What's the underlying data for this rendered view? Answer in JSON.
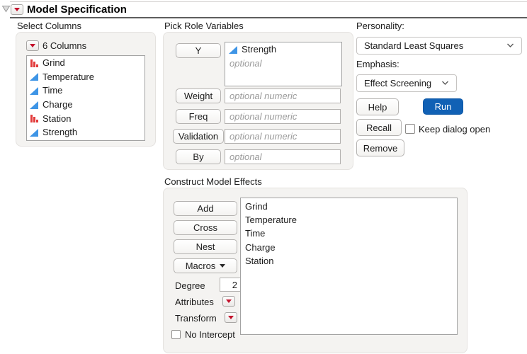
{
  "title": {
    "text": "Model Specification"
  },
  "select_columns": {
    "label": "Select Columns",
    "count_label": "6 Columns",
    "columns": [
      {
        "name": "Grind",
        "type": "nominal"
      },
      {
        "name": "Temperature",
        "type": "continuous"
      },
      {
        "name": "Time",
        "type": "continuous"
      },
      {
        "name": "Charge",
        "type": "continuous"
      },
      {
        "name": "Station",
        "type": "nominal"
      },
      {
        "name": "Strength",
        "type": "continuous"
      }
    ]
  },
  "pick_roles": {
    "label": "Pick Role Variables",
    "y_button": "Y",
    "y_assigned": "Strength",
    "y_assigned_type": "continuous",
    "y_placeholder": "optional",
    "rows": [
      {
        "button": "Weight",
        "placeholder": "optional numeric"
      },
      {
        "button": "Freq",
        "placeholder": "optional numeric"
      },
      {
        "button": "Validation",
        "placeholder": "optional numeric"
      },
      {
        "button": "By",
        "placeholder": "optional"
      }
    ]
  },
  "personality": {
    "label": "Personality:",
    "value": "Standard Least Squares",
    "emphasis_label": "Emphasis:",
    "emphasis_value": "Effect Screening"
  },
  "actions": {
    "help": "Help",
    "run": "Run",
    "recall": "Recall",
    "remove": "Remove",
    "keep_dialog_label": "Keep dialog open",
    "keep_dialog_checked": false
  },
  "model_effects": {
    "label": "Construct Model Effects",
    "buttons": [
      "Add",
      "Cross",
      "Nest"
    ],
    "macros_label": "Macros",
    "degree_label": "Degree",
    "degree_value": "2",
    "attributes_label": "Attributes",
    "transform_label": "Transform",
    "no_intercept_label": "No Intercept",
    "no_intercept_checked": false,
    "effects": [
      "Grind",
      "Temperature",
      "Time",
      "Charge",
      "Station"
    ]
  },
  "icons": {
    "continuous": "blue-right-triangle",
    "nominal": "red-bar-chart",
    "menu": "red-down-triangle",
    "disclosure": "gray-down-triangle"
  },
  "colors": {
    "run_button": "#1161b5",
    "continuous_icon": "#3e95e6",
    "nominal_icon": "#e23b3b",
    "red_triangle": "#c3112b",
    "panel_background": "#f4f3f1"
  }
}
